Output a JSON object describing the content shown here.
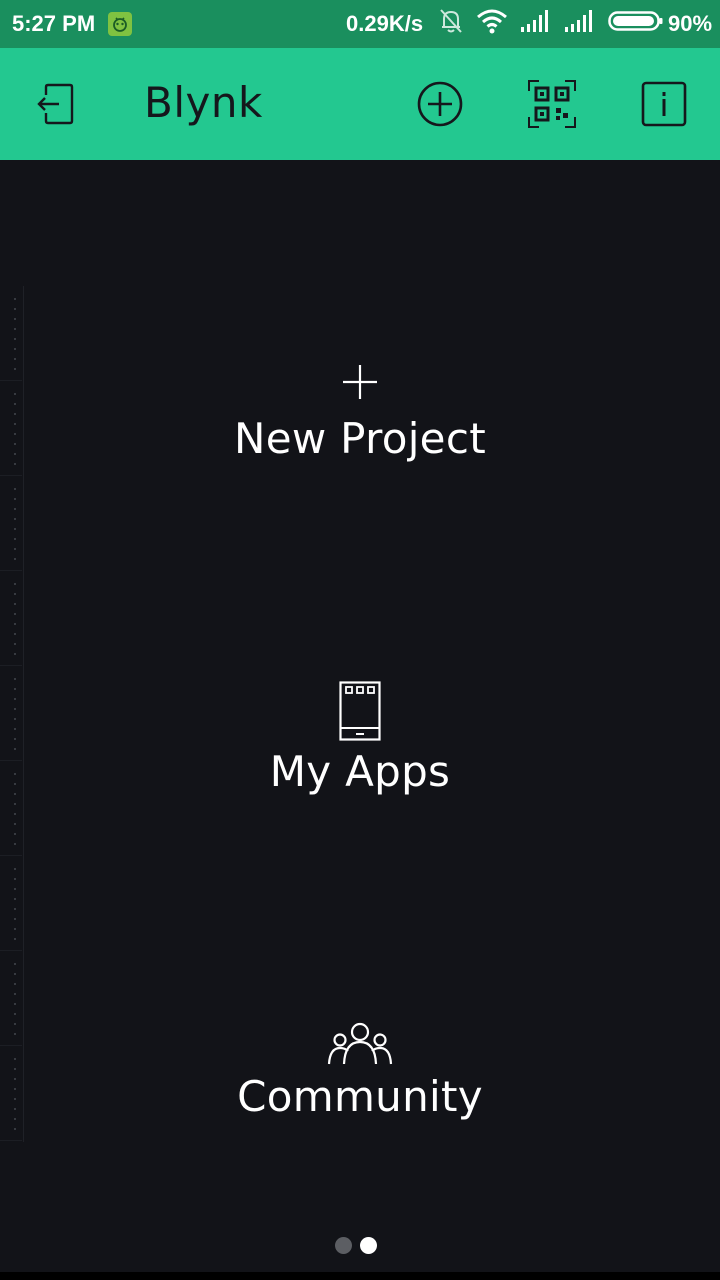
{
  "status_bar": {
    "time": "5:27 PM",
    "network_speed": "0.29K/s",
    "battery_percent": "90%",
    "icons": [
      "app-notification-icon",
      "bell-off-icon",
      "wifi-icon",
      "signal-icon",
      "signal-icon",
      "battery-icon"
    ]
  },
  "app_bar": {
    "title": "Blynk",
    "background_color": "#23c890",
    "actions": [
      "logout-icon",
      "add-circle-icon",
      "qr-scan-icon",
      "info-icon"
    ]
  },
  "menu": {
    "new_project": {
      "label": "New Project",
      "icon": "plus-icon"
    },
    "my_apps": {
      "label": "My Apps",
      "icon": "phone-app-icon"
    },
    "community": {
      "label": "Community",
      "icon": "community-people-icon"
    }
  },
  "pager": {
    "count": 2,
    "active_index": 1
  },
  "colors": {
    "background": "#121318",
    "status_bar": "#1a8f5e",
    "accent": "#23c890",
    "text": "#ffffff"
  }
}
